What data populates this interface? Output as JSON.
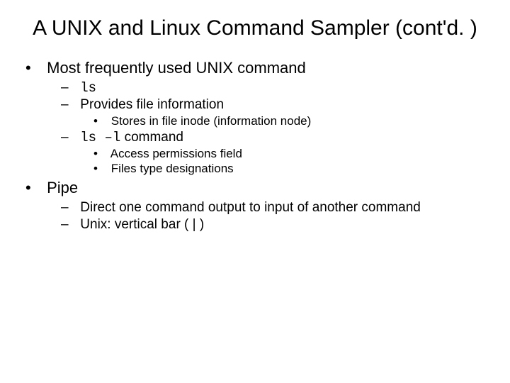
{
  "title": "A UNIX and Linux Command Sampler (cont'd. )",
  "bullets": {
    "b1": "Most frequently used UNIX command",
    "b1_1_code": "ls",
    "b1_2": "Provides file information",
    "b1_2_1": "Stores in file inode (information node)",
    "b1_3_code": "ls –l",
    "b1_3_tail": " command",
    "b1_3_1": "Access permissions field",
    "b1_3_2": "Files type designations",
    "b2": "Pipe",
    "b2_1": "Direct one command output to input of another command",
    "b2_2": "Unix: vertical bar ( | )"
  }
}
